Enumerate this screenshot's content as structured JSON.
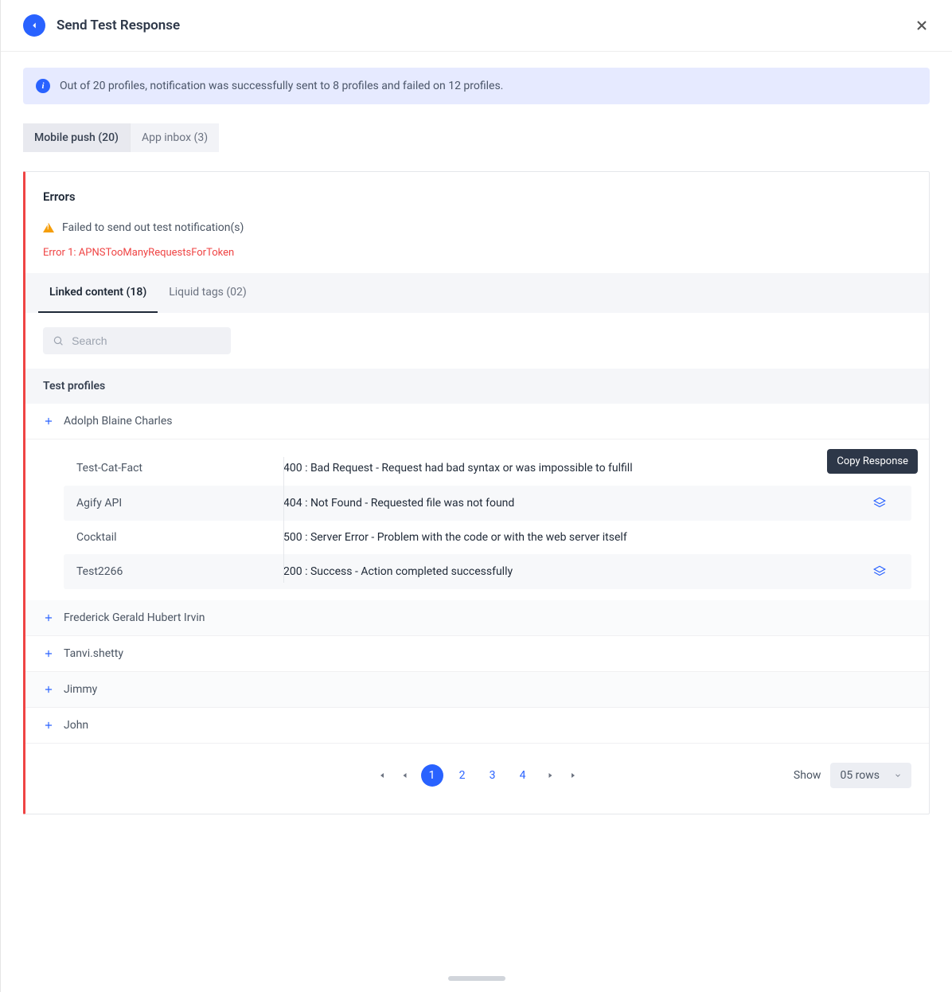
{
  "header": {
    "title": "Send Test Response"
  },
  "banner": {
    "text": "Out of 20 profiles, notification was successfully sent to 8 profiles and failed on 12 profiles."
  },
  "channel_tabs": [
    {
      "label": "Mobile push (20)",
      "active": true
    },
    {
      "label": "App inbox (3)",
      "active": false
    }
  ],
  "errors": {
    "heading": "Errors",
    "warn": "Failed to send out test notification(s)",
    "code": "Error 1: APNSTooManyRequestsForToken"
  },
  "inner_tabs": [
    {
      "label": "Linked content (18)",
      "active": true
    },
    {
      "label": "Liquid tags (02)",
      "active": false
    }
  ],
  "search": {
    "placeholder": "Search",
    "value": ""
  },
  "section_head": "Test profiles",
  "profiles": [
    {
      "name": "Adolph Blaine Charles",
      "expanded": true
    },
    {
      "name": "Frederick Gerald Hubert Irvin",
      "expanded": false
    },
    {
      "name": "Tanvi.shetty",
      "expanded": false
    },
    {
      "name": "Jimmy",
      "expanded": false
    },
    {
      "name": "John",
      "expanded": false
    }
  ],
  "responses": [
    {
      "name": "Test-Cat-Fact",
      "status": "400 : Bad Request - Request had bad syntax or was impossible to fulfill",
      "copyable": true,
      "tooltip": true
    },
    {
      "name": "Agify API",
      "status": "404 : Not Found - Requested file was not found",
      "copyable": true
    },
    {
      "name": "Cocktail",
      "status": "500 : Server Error - Problem with the code or with the web server itself",
      "copyable": false
    },
    {
      "name": "Test2266",
      "status": "200 : Success - Action completed successfully",
      "copyable": true
    }
  ],
  "tooltip_text": "Copy Response",
  "pagination": {
    "pages": [
      "1",
      "2",
      "3",
      "4"
    ],
    "active": 0,
    "show_label": "Show",
    "rows_value": "05 rows"
  }
}
